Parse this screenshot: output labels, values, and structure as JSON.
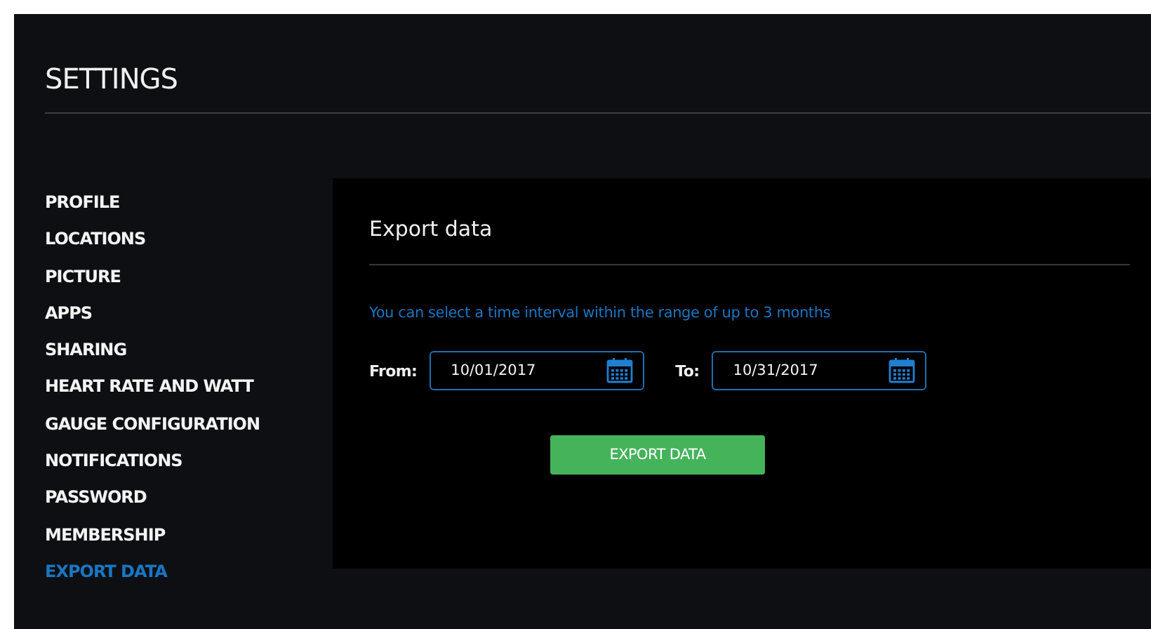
{
  "title": "SETTINGS",
  "sidebar": {
    "items": [
      {
        "label": "PROFILE",
        "selected": false
      },
      {
        "label": "LOCATIONS",
        "selected": false
      },
      {
        "label": "PICTURE",
        "selected": false
      },
      {
        "label": "APPS",
        "selected": false
      },
      {
        "label": "SHARING",
        "selected": false
      },
      {
        "label": "HEART RATE AND WATT",
        "selected": false
      },
      {
        "label": "GAUGE CONFIGURATION",
        "selected": false
      },
      {
        "label": "NOTIFICATIONS",
        "selected": false
      },
      {
        "label": "PASSWORD",
        "selected": false
      },
      {
        "label": "MEMBERSHIP",
        "selected": false
      },
      {
        "label": "EXPORT DATA",
        "selected": true
      }
    ]
  },
  "panel": {
    "title": "Export data",
    "hint": "You can select a time interval within the range of up to 3 months",
    "fields": [
      {
        "label": "From:",
        "value": "10/01/2017"
      },
      {
        "label": "To:",
        "value": "10/31/2017"
      }
    ],
    "button": "EXPORT DATA"
  }
}
